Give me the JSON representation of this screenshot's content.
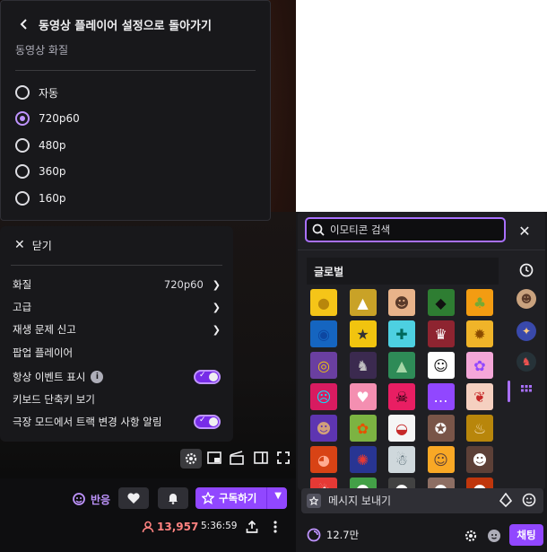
{
  "quality_menu": {
    "back_label": "동영상 플레이어 설정으로 돌아가기",
    "section_title": "동영상 화질",
    "options": [
      {
        "label": "자동",
        "selected": false
      },
      {
        "label": "720p60",
        "selected": true
      },
      {
        "label": "480p",
        "selected": false
      },
      {
        "label": "360p",
        "selected": false
      },
      {
        "label": "160p",
        "selected": false
      }
    ]
  },
  "settings_menu": {
    "close_label": "닫기",
    "items": [
      {
        "label": "화질",
        "value": "720p60",
        "has_arrow": true
      },
      {
        "label": "고급",
        "value": "",
        "has_arrow": true
      },
      {
        "label": "재생 문제 신고",
        "value": "",
        "has_arrow": true
      },
      {
        "label": "팝업 플레이어",
        "value": "",
        "has_arrow": false
      },
      {
        "label": "항상 이벤트 표시",
        "value": "",
        "info": "i",
        "toggle": true
      },
      {
        "label": "키보드 단축키 보기",
        "value": "",
        "has_arrow": false
      },
      {
        "label": "극장 모드에서 트랙 변경 사항 알림",
        "value": "",
        "toggle": true
      }
    ]
  },
  "channel_bar": {
    "react_label": "반응",
    "subscribe_label": "구독하기",
    "viewer_count": "13,957",
    "uptime": "5:36:59"
  },
  "emote_picker": {
    "search_placeholder": "이모티콘 검색",
    "section_title": "글로벌",
    "close_icon": "close-icon",
    "emote_rows": [
      [
        {
          "bg": "#f5c518",
          "fg": "#b8860b",
          "g": "●"
        },
        {
          "bg": "#c9a227",
          "fg": "#fff",
          "g": "▲"
        },
        {
          "bg": "#e8b38a",
          "fg": "#5a3a2a",
          "g": "☻"
        },
        {
          "bg": "#2e7d32",
          "fg": "#111",
          "g": "◆"
        },
        {
          "bg": "#f39c12",
          "fg": "#7a3",
          "g": "♣"
        }
      ],
      [
        {
          "bg": "#1565c0",
          "fg": "#0d47a1",
          "g": "◉"
        },
        {
          "bg": "#f1c40f",
          "fg": "#333",
          "g": "★"
        },
        {
          "bg": "#4dd0e1",
          "fg": "#00695c",
          "g": "✚"
        },
        {
          "bg": "#8e2430",
          "fg": "#fff",
          "g": "♛"
        },
        {
          "bg": "#f0b429",
          "fg": "#8a4b00",
          "g": "✹"
        }
      ],
      [
        {
          "bg": "#6a3fa0",
          "fg": "#f1c40f",
          "g": "◎"
        },
        {
          "bg": "#3b2a4f",
          "fg": "#c0c0c0",
          "g": "♞"
        },
        {
          "bg": "#2e8b57",
          "fg": "#a5d6a7",
          "g": "▲"
        },
        {
          "bg": "#ffffff",
          "fg": "#111",
          "g": "☺"
        },
        {
          "bg": "#f4a7d8",
          "fg": "#9147ff",
          "g": "✿"
        }
      ],
      [
        {
          "bg": "#d81b60",
          "fg": "#00e5ff",
          "g": "☹"
        },
        {
          "bg": "#f48fb1",
          "fg": "#fff",
          "g": "♥"
        },
        {
          "bg": "#e91e63",
          "fg": "#000",
          "g": "☠"
        },
        {
          "bg": "#9147ff",
          "fg": "#fff",
          "g": "…"
        },
        {
          "bg": "#f5d0c0",
          "fg": "#c62828",
          "g": "❦"
        }
      ],
      [
        {
          "bg": "#5e35b1",
          "fg": "#d1a07a",
          "g": "☻"
        },
        {
          "bg": "#7cb342",
          "fg": "#e65100",
          "g": "✿"
        },
        {
          "bg": "#f5f5f5",
          "fg": "#c62828",
          "g": "◒"
        },
        {
          "bg": "#795548",
          "fg": "#fff",
          "g": "✪"
        },
        {
          "bg": "#b8860b",
          "fg": "#f5deb3",
          "g": "♨"
        }
      ],
      [
        {
          "bg": "#d84315",
          "fg": "#ffab91",
          "g": "◕"
        },
        {
          "bg": "#283593",
          "fg": "#e53935",
          "g": "✺"
        },
        {
          "bg": "#cfd8dc",
          "fg": "#455a64",
          "g": "☃"
        },
        {
          "bg": "#f9a825",
          "fg": "#5d4037",
          "g": "☺"
        },
        {
          "bg": "#5d4037",
          "fg": "#fff",
          "g": "☻"
        }
      ],
      [
        {
          "bg": "#e53935",
          "fg": "#fff",
          "g": "☃"
        },
        {
          "bg": "#43a047",
          "fg": "#fff",
          "g": "☻"
        },
        {
          "bg": "#424242",
          "fg": "#fff",
          "g": "☻"
        },
        {
          "bg": "#8d6e63",
          "fg": "#fff",
          "g": "☻"
        },
        {
          "bg": "#bf360c",
          "fg": "#fff",
          "g": "☻"
        }
      ]
    ],
    "sidebar_tabs": [
      "clock-icon",
      "avatar-1",
      "avatar-2",
      "avatar-3",
      "global-grid-icon"
    ]
  },
  "chat": {
    "input_placeholder": "메시지 보내기",
    "points": "12.7만",
    "send_label": "채팅"
  },
  "colors": {
    "accent": "#9147ff",
    "accent_light": "#bf94ff",
    "live_red": "#ff8280",
    "panel_bg": "#18181b"
  }
}
